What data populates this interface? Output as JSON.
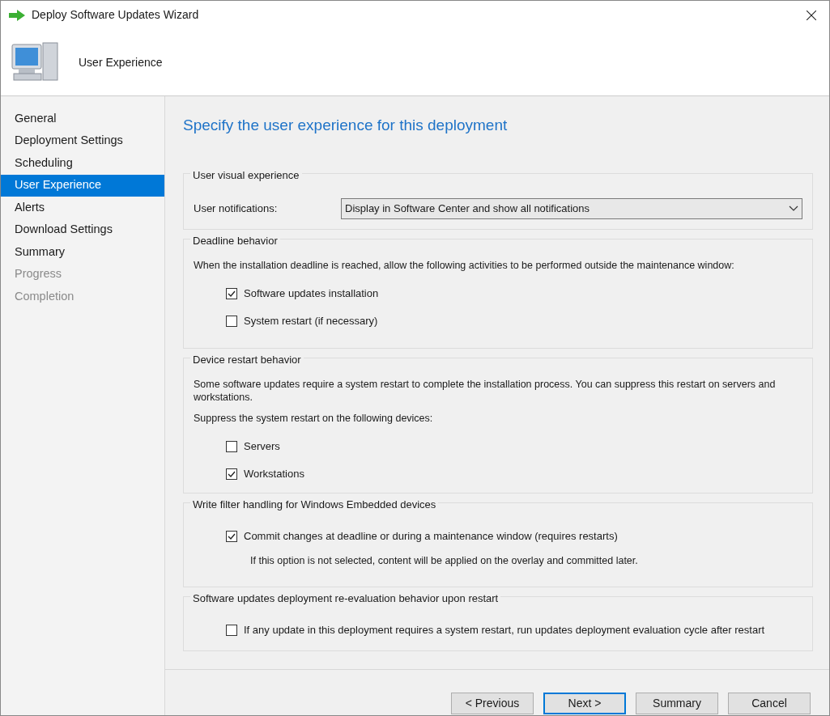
{
  "window": {
    "title": "Deploy Software Updates Wizard"
  },
  "header": {
    "title": "User Experience"
  },
  "sidebar": {
    "items": [
      {
        "label": "General",
        "selected": false,
        "disabled": false
      },
      {
        "label": "Deployment Settings",
        "selected": false,
        "disabled": false
      },
      {
        "label": "Scheduling",
        "selected": false,
        "disabled": false
      },
      {
        "label": "User Experience",
        "selected": true,
        "disabled": false
      },
      {
        "label": "Alerts",
        "selected": false,
        "disabled": false
      },
      {
        "label": "Download Settings",
        "selected": false,
        "disabled": false
      },
      {
        "label": "Summary",
        "selected": false,
        "disabled": false
      },
      {
        "label": "Progress",
        "selected": false,
        "disabled": true
      },
      {
        "label": "Completion",
        "selected": false,
        "disabled": true
      }
    ]
  },
  "page": {
    "heading": "Specify the user experience for this deployment",
    "groups": [
      {
        "title": "User visual experience",
        "items": [
          {
            "kind": "dropdown",
            "label": "User notifications:",
            "value": "Display in Software Center and show all notifications"
          }
        ]
      },
      {
        "title": "Deadline behavior",
        "items": [
          {
            "kind": "text",
            "text": "When the installation deadline is reached, allow the following activities to be performed outside the maintenance window:"
          },
          {
            "kind": "checkbox",
            "label": "Software updates installation",
            "checked": true
          },
          {
            "kind": "checkbox",
            "label": "System restart (if necessary)",
            "checked": false
          }
        ]
      },
      {
        "title": "Device restart behavior",
        "items": [
          {
            "kind": "text",
            "text": "Some software updates require a system restart to complete the installation process. You can suppress this restart on servers and workstations."
          },
          {
            "kind": "text",
            "text": "Suppress the system restart on the following devices:"
          },
          {
            "kind": "checkbox",
            "label": "Servers",
            "checked": false
          },
          {
            "kind": "checkbox",
            "label": "Workstations",
            "checked": true
          }
        ]
      },
      {
        "title": "Write filter handling for Windows Embedded devices",
        "items": [
          {
            "kind": "checkbox",
            "label": "Commit changes at deadline or during a maintenance window (requires restarts)",
            "checked": true
          },
          {
            "kind": "note",
            "text": "If this option is not selected, content will be applied on the overlay and committed later."
          }
        ]
      },
      {
        "title": "Software updates deployment re-evaluation behavior upon restart",
        "items": [
          {
            "kind": "checkbox",
            "label": "If any update in this deployment requires a system restart, run updates deployment evaluation cycle after restart",
            "checked": false
          }
        ]
      }
    ]
  },
  "buttons": [
    {
      "label": "< Previous",
      "default": false
    },
    {
      "label": "Next >",
      "default": true
    },
    {
      "label": "Summary",
      "default": false
    },
    {
      "label": "Cancel",
      "default": false
    }
  ]
}
